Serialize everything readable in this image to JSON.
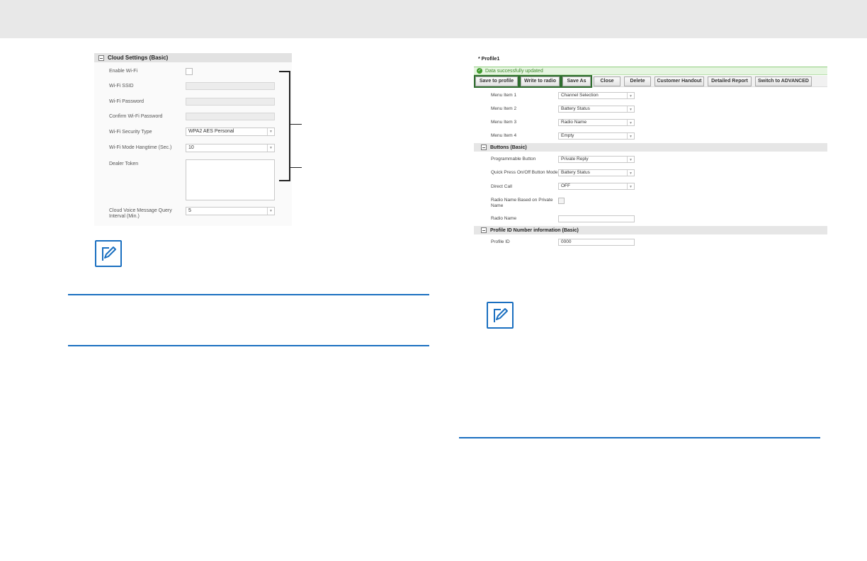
{
  "cloud_settings": {
    "title": "Cloud Settings (Basic)",
    "fields": {
      "enable_wifi": "Enable Wi-Fi",
      "wifi_ssid": "Wi-Fi SSID",
      "wifi_password": "Wi-Fi Password",
      "confirm_wifi_password": "Confirm Wi-Fi Password",
      "security_type_label": "Wi-Fi Security Type",
      "security_type_value": "WPA2 AES Personal",
      "hangtime_label": "Wi-Fi Mode Hangtime (Sec.)",
      "hangtime_value": "10",
      "dealer_token": "Dealer Token",
      "query_interval_label_1": "Cloud Voice Message Query",
      "query_interval_label_2": "Interval (Min.)",
      "query_interval_value": "5"
    }
  },
  "profile": {
    "title": "* Profile1",
    "success_message": "Data successfully updated",
    "toolbar": {
      "save_to_profile": "Save to profile",
      "write_to_radio": "Write to radio",
      "save_as": "Save As",
      "close": "Close",
      "delete": "Delete",
      "customer_handout": "Customer Handout",
      "detailed_report": "Detailed Report",
      "switch_advanced": "Switch to ADVANCED"
    },
    "menu_items": [
      {
        "label": "Menu Item 1",
        "value": "Channel Selection"
      },
      {
        "label": "Menu Item 2",
        "value": "Battery Status"
      },
      {
        "label": "Menu Item 3",
        "value": "Radio Name"
      },
      {
        "label": "Menu Item 4",
        "value": "Empty"
      }
    ],
    "buttons_section": {
      "title": "Buttons (Basic)",
      "programmable_label": "Programmable Button",
      "programmable_value": "Private Reply",
      "quick_press_label": "Quick Press On/Off Button Mode",
      "quick_press_value": "Battery Status",
      "direct_call_label": "Direct Call",
      "direct_call_value": "OFF",
      "radio_name_private_label_1": "Radio Name Based on Private",
      "radio_name_private_label_2": "Name",
      "radio_name_label": "Radio Name",
      "radio_name_value": ""
    },
    "id_section": {
      "title": "Profile ID Number information (Basic)",
      "profile_id_label": "Profile ID",
      "profile_id_value": "0000"
    }
  },
  "icons": {
    "note_left": "note-pencil-icon",
    "note_right": "note-pencil-icon"
  },
  "colors": {
    "accent_blue": "#1a6fc0",
    "success_green": "#3f9b2c",
    "highlight_green": "#2f6e2f"
  }
}
